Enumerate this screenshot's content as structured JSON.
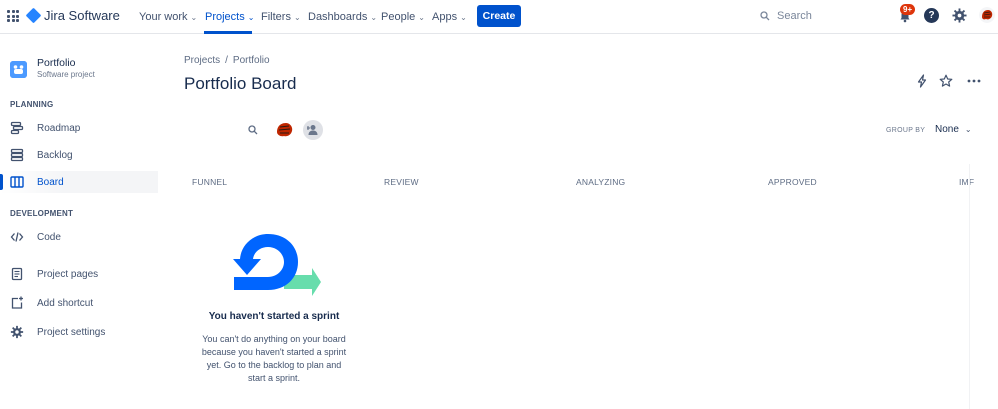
{
  "topnav": {
    "app_name": "Jira Software",
    "items": [
      {
        "label": "Your work"
      },
      {
        "label": "Projects"
      },
      {
        "label": "Filters"
      },
      {
        "label": "Dashboards"
      },
      {
        "label": "People"
      },
      {
        "label": "Apps"
      }
    ],
    "create_label": "Create",
    "search_placeholder": "Search",
    "notification_badge": "9+",
    "help_glyph": "?"
  },
  "sidebar": {
    "project_name": "Portfolio",
    "project_type": "Software project",
    "planning_title": "PLANNING",
    "planning_items": [
      {
        "label": "Roadmap",
        "icon": "roadmap-icon"
      },
      {
        "label": "Backlog",
        "icon": "backlog-icon"
      },
      {
        "label": "Board",
        "icon": "board-icon"
      }
    ],
    "development_title": "DEVELOPMENT",
    "development_items": [
      {
        "label": "Code",
        "icon": "code-icon"
      }
    ],
    "extra_items": [
      {
        "label": "Project pages",
        "icon": "page-icon"
      },
      {
        "label": "Add shortcut",
        "icon": "add-shortcut-icon"
      },
      {
        "label": "Project settings",
        "icon": "gear-icon"
      }
    ]
  },
  "main": {
    "breadcrumb": [
      "Projects",
      "/",
      "Portfolio"
    ],
    "title": "Portfolio Board",
    "group_by_label": "GROUP BY",
    "group_by_value": "None",
    "columns": [
      "FUNNEL",
      "REVIEW",
      "ANALYZING",
      "APPROVED",
      "IMF"
    ],
    "empty_state": {
      "title": "You haven't started a sprint",
      "description": "You can't do anything on your board because you haven't started a sprint yet. Go to the backlog to plan and start a sprint."
    }
  },
  "colors": {
    "brand": "#0052cc",
    "accent_blue": "#0065ff",
    "accent_green": "#57d9a3",
    "badge_red": "#de350b"
  }
}
